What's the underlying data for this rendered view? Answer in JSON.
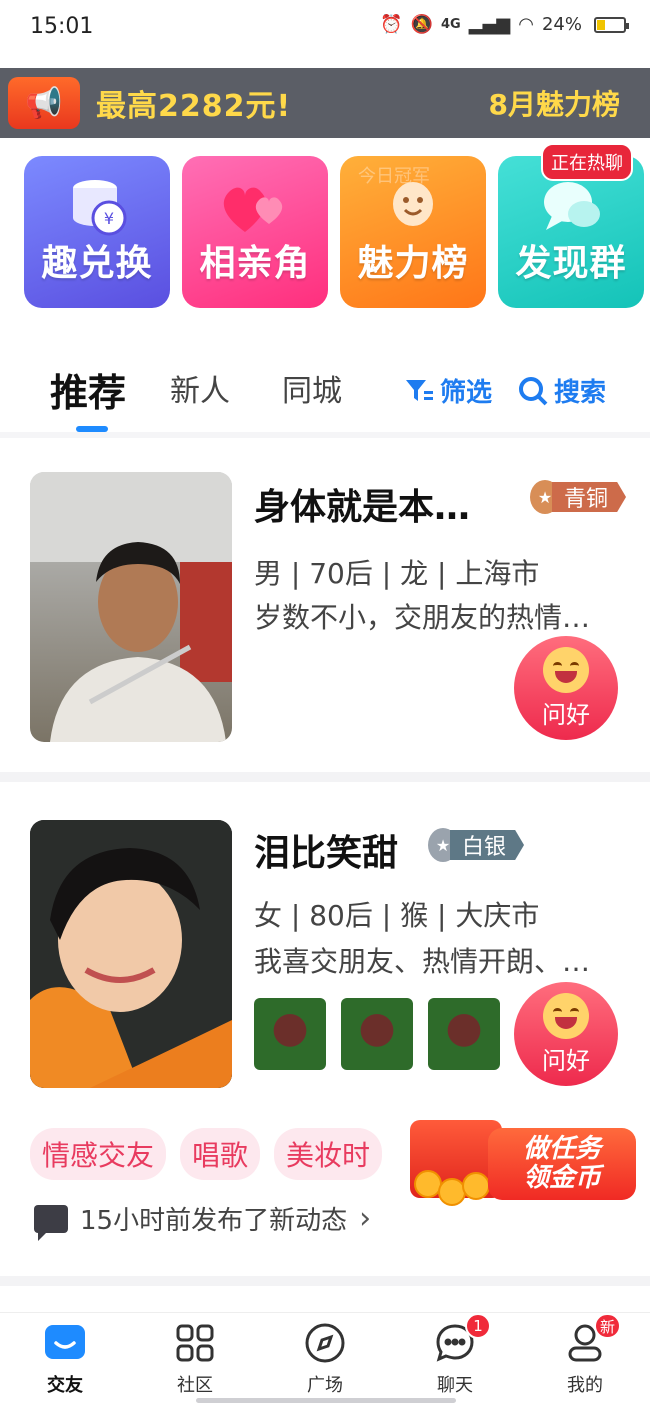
{
  "status_bar": {
    "time": "15:01",
    "network": "4G",
    "battery": "24%"
  },
  "banner": {
    "text_left": "最高2282元!",
    "text_right": "8月魅力榜"
  },
  "features": [
    {
      "label": "趣兑换",
      "icon": "coins-icon"
    },
    {
      "label": "相亲角",
      "icon": "hearts-icon"
    },
    {
      "label": "魅力榜",
      "icon": "trophy-icon",
      "watermark": "今日冠军"
    },
    {
      "label": "发现群",
      "icon": "chat-bubbles-icon",
      "badge": "正在热聊"
    }
  ],
  "tabs": {
    "items": [
      "推荐",
      "新人",
      "同城"
    ],
    "active_index": 0,
    "filter_label": "筛选",
    "search_label": "搜索"
  },
  "profiles": [
    {
      "name": "身体就是本…",
      "medal": "青铜",
      "info": "男 | 70后 | 龙 | 上海市",
      "bio": "岁数不小，交朋友的热情…",
      "greet_label": "问好"
    },
    {
      "name": "泪比笑甜",
      "medal": "白银",
      "info": "女 | 80后 | 猴 | 大庆市",
      "bio": "我喜交朋友、热情开朗、…",
      "greet_label": "问好",
      "tags": [
        "情感交友",
        "唱歌",
        "美妆时"
      ],
      "activity": "15小时前发布了新动态"
    }
  ],
  "task_float": {
    "line1": "做任务",
    "line2": "领金币"
  },
  "bottom_nav": [
    {
      "label": "交友",
      "active": true
    },
    {
      "label": "社区"
    },
    {
      "label": "广场"
    },
    {
      "label": "聊天",
      "badge": "1"
    },
    {
      "label": "我的",
      "badge": "新"
    }
  ],
  "colors": {
    "accent": "#1e8bff",
    "greet": "#ee2a4d",
    "tag_bg": "#fde8ee",
    "banner_text": "#ffd94a"
  }
}
